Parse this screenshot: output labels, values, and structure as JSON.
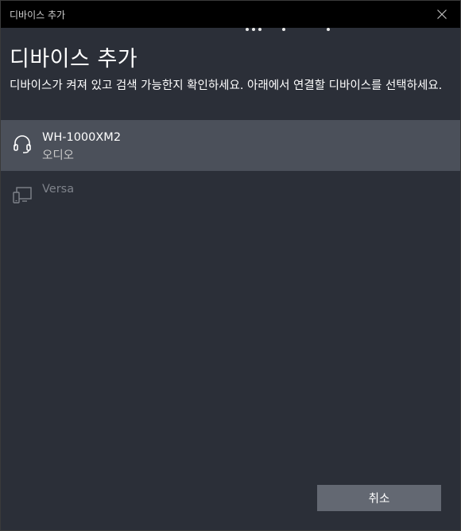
{
  "window": {
    "title": "디바이스 추가"
  },
  "heading": "디바이스 추가",
  "description": "디바이스가 켜져 있고 검색 가능한지 확인하세요. 아래에서 연결할 디바이스를 선택하세요.",
  "devices": [
    {
      "name": "WH-1000XM2",
      "type": "오디오",
      "icon": "headset-icon",
      "selected": true
    },
    {
      "name": "Versa",
      "type": "",
      "icon": "device-icon",
      "selected": false
    }
  ],
  "buttons": {
    "cancel_label": "취소"
  },
  "colors": {
    "background": "#2b2f38",
    "titlebar": "#000000",
    "selected_row": "#4b505a",
    "button": "#636872"
  }
}
